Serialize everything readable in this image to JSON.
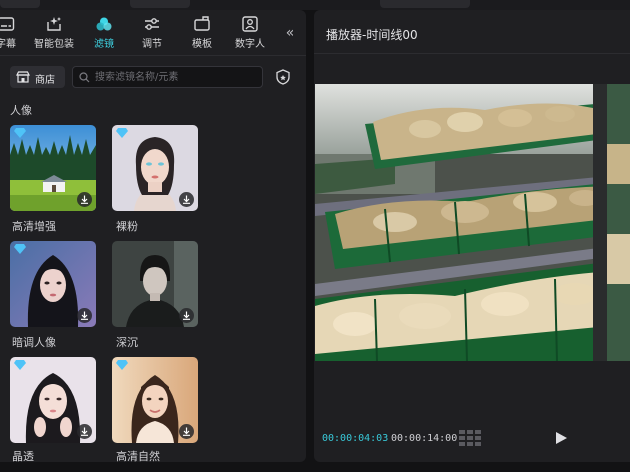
{
  "toolbar": {
    "tabs": [
      {
        "label": "字幕",
        "icon": "subtitle-icon"
      },
      {
        "label": "智能包装",
        "icon": "sparkle-box-icon"
      },
      {
        "label": "滤镜",
        "icon": "filter-icon",
        "active": true
      },
      {
        "label": "调节",
        "icon": "adjust-sliders-icon"
      },
      {
        "label": "模板",
        "icon": "template-icon"
      },
      {
        "label": "数字人",
        "icon": "digital-human-icon"
      }
    ],
    "collapse_label": "«"
  },
  "store": {
    "label": "商店"
  },
  "search": {
    "placeholder": "搜索滤镜名称/元素",
    "value": ""
  },
  "section": {
    "title": "人像"
  },
  "filters": [
    {
      "label": "高清增强",
      "premium": true
    },
    {
      "label": "裸粉",
      "premium": true
    },
    {
      "label": "暗调人像",
      "premium": true
    },
    {
      "label": "深沉",
      "premium": false
    },
    {
      "label": "晶透",
      "premium": true
    },
    {
      "label": "高清自然",
      "premium": true
    }
  ],
  "player": {
    "title": "播放器-时间线00",
    "current_time": "00:00:04:03",
    "total_time": "00:00:14:00"
  },
  "colors": {
    "accent": "#3fd6e6",
    "panel": "#1f1f22",
    "background": "#121214"
  }
}
